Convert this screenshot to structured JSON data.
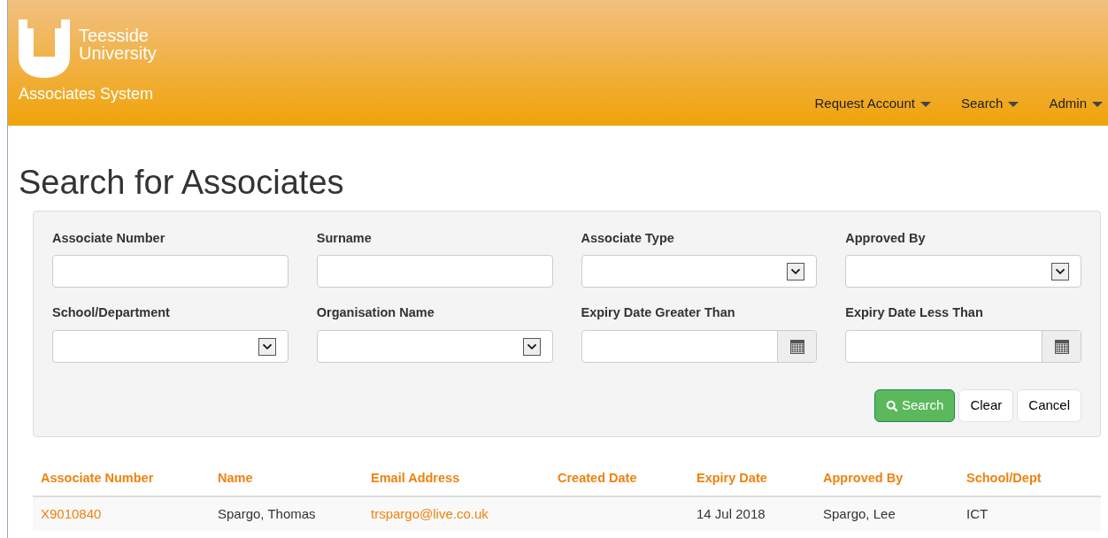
{
  "header": {
    "logo_line_1": "Teesside",
    "logo_line_2": "University",
    "system_name": "Associates System",
    "nav": [
      {
        "label": "Request Account"
      },
      {
        "label": "Search"
      },
      {
        "label": "Admin"
      }
    ]
  },
  "page_title": "Search for Associates",
  "filters": [
    {
      "label": "Associate Number",
      "kind": "text"
    },
    {
      "label": "Surname",
      "kind": "text"
    },
    {
      "label": "Associate Type",
      "kind": "select"
    },
    {
      "label": "Approved By",
      "kind": "select"
    },
    {
      "label": "School/Department",
      "kind": "select"
    },
    {
      "label": "Organisation Name",
      "kind": "select"
    },
    {
      "label": "Expiry Date Greater Than",
      "kind": "date"
    },
    {
      "label": "Expiry Date Less Than",
      "kind": "date"
    }
  ],
  "buttons": [
    {
      "label": "Search",
      "kind": "primary"
    },
    {
      "label": "Clear",
      "kind": "default"
    },
    {
      "label": "Cancel",
      "kind": "default"
    }
  ],
  "table": {
    "columns": [
      {
        "label": "Associate Number",
        "kind": "link"
      },
      {
        "label": "Name",
        "kind": "text"
      },
      {
        "label": "Email Address",
        "kind": "link"
      },
      {
        "label": "Created Date",
        "kind": "text"
      },
      {
        "label": "Expiry Date",
        "kind": "text"
      },
      {
        "label": "Approved By",
        "kind": "text"
      },
      {
        "label": "School/Dept",
        "kind": "text"
      }
    ],
    "rows": [
      [
        "X9010840",
        "Spargo, Thomas",
        "trspargo@live.co.uk",
        "",
        "14 Jul 2018",
        "Spargo, Lee",
        "ICT"
      ]
    ]
  }
}
